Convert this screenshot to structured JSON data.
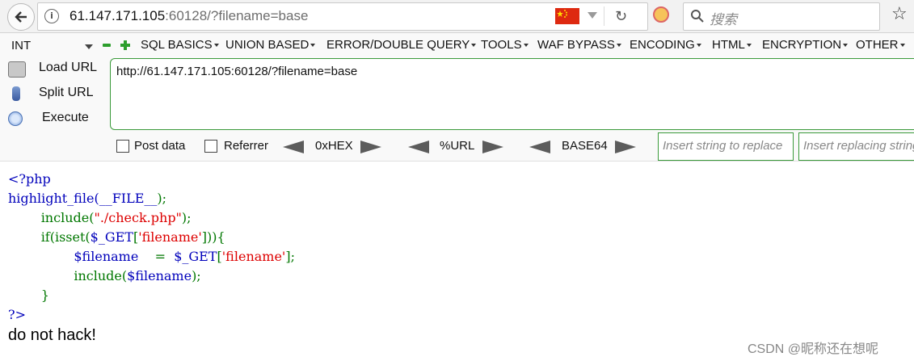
{
  "browser": {
    "url_host": "61.147.171.105",
    "url_rest": ":60128/?filename=base",
    "search_placeholder": "搜索"
  },
  "hackbar": {
    "select_value": "INT",
    "menus": [
      "SQL BASICS",
      "UNION BASED",
      "ERROR/DOUBLE QUERY",
      "TOOLS",
      "WAF BYPASS",
      "ENCODING",
      "HTML",
      "ENCRYPTION",
      "OTHER"
    ],
    "load_url": "Load URL",
    "split_url": "Split URL",
    "execute": "Execute",
    "url_value": "http://61.147.171.105:60128/?filename=base",
    "post_data": "Post data",
    "referrer": "Referrer",
    "hex": "0xHEX",
    "url_enc": "%URL",
    "base64": "BASE64",
    "insert_placeholder": "Insert string to replace",
    "replacing_placeholder": "Insert replacing string"
  },
  "code": {
    "line1": "<?php",
    "line2_fn": "highlight_file(",
    "line2_const": "__FILE__",
    "line2_end": ");",
    "line3_fn": "include(",
    "line3_str": "\"./check.php\"",
    "line3_end": ");",
    "line4_a": "if(isset(",
    "line4_var": "$_GET",
    "line4_b": "[",
    "line4_str": "'filename'",
    "line4_c": "])){",
    "line5_var": "$filename",
    "line5_eq": "=",
    "line5_get": "$_GET",
    "line5_b": "[",
    "line5_str": "'filename'",
    "line5_c": "];",
    "line6_fn": "include(",
    "line6_var": "$filename",
    "line6_end": ");",
    "line7": "}",
    "line8": "?>"
  },
  "message": "do not hack!",
  "watermark": "CSDN @昵称还在想呢"
}
